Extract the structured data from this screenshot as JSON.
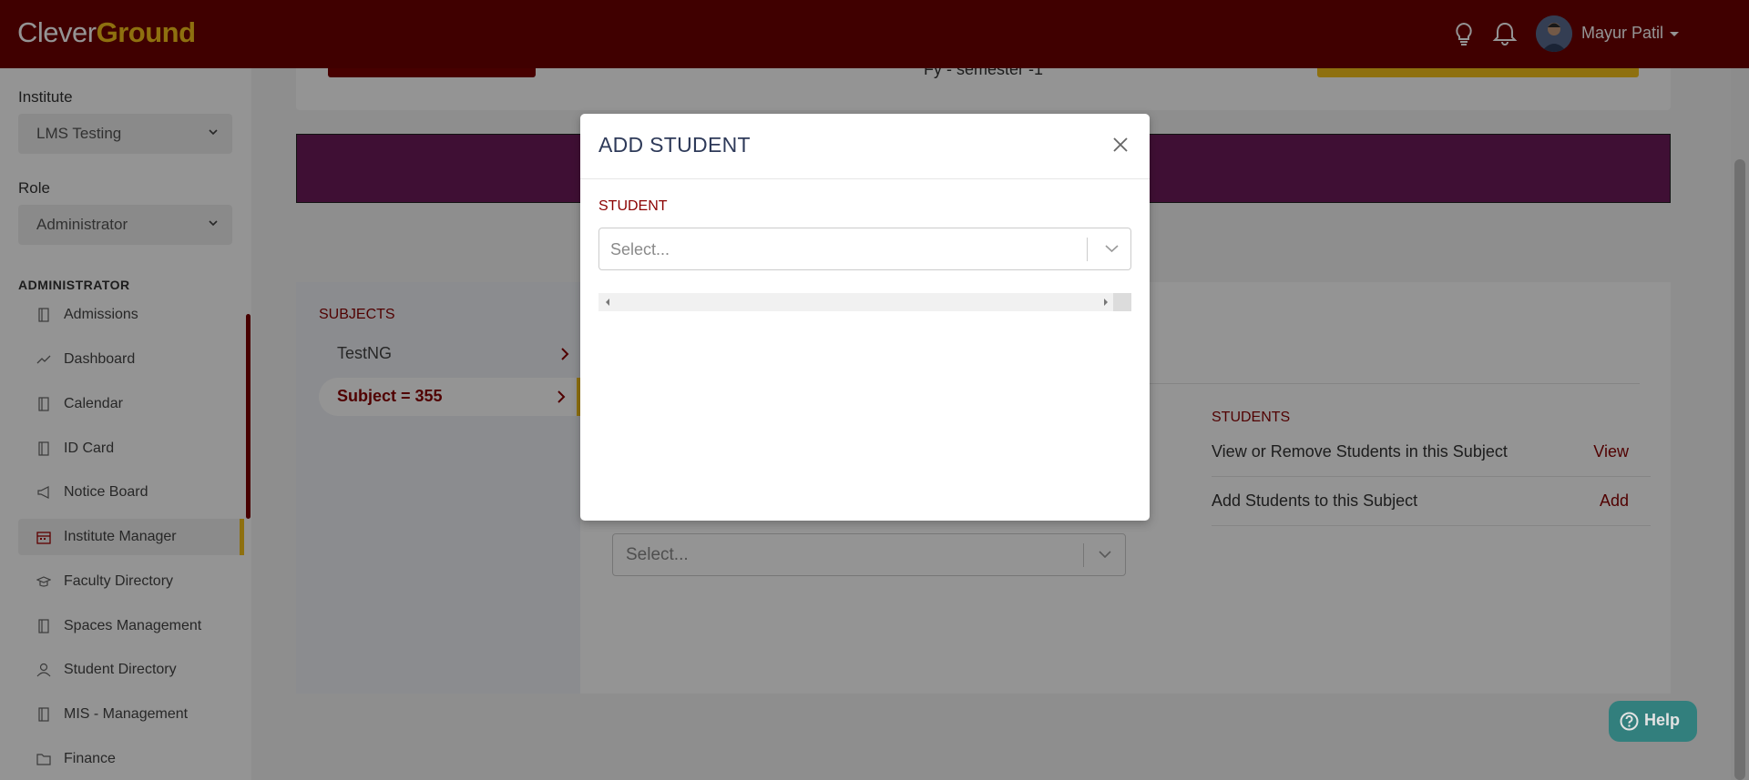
{
  "header": {
    "logo_part1": "Clever",
    "logo_part2": "Ground",
    "user_name": "Mayur Patil",
    "bg_color": "#6e0000",
    "accent_color": "#f5c21b"
  },
  "sidebar": {
    "institute_label": "Institute",
    "institute_value": "LMS Testing",
    "role_label": "Role",
    "role_value": "Administrator",
    "section_title": "ADMINISTRATOR",
    "items": [
      {
        "label": "Admissions",
        "icon": "book-icon"
      },
      {
        "label": "Dashboard",
        "icon": "trend-icon"
      },
      {
        "label": "Calendar",
        "icon": "book-icon"
      },
      {
        "label": "ID Card",
        "icon": "book-icon"
      },
      {
        "label": "Notice Board",
        "icon": "megaphone-icon"
      },
      {
        "label": "Institute Manager",
        "icon": "calendar-icon",
        "active": true
      },
      {
        "label": "Faculty Directory",
        "icon": "graduation-cap-icon"
      },
      {
        "label": "Spaces Management",
        "icon": "book-icon"
      },
      {
        "label": "Student Directory",
        "icon": "user-icon"
      },
      {
        "label": "MIS - Management",
        "icon": "book-icon"
      },
      {
        "label": "Finance",
        "icon": "folder-icon"
      }
    ]
  },
  "main": {
    "fy_text": "Fy - semester -1",
    "subjects_title": "SUBJECTS",
    "subjects": [
      {
        "label": "TestNG"
      },
      {
        "label": "Subject = 355",
        "active": true
      }
    ],
    "students_title": "STUDENTS",
    "students_rows": [
      {
        "text": "View or Remove Students in this Subject",
        "link": "View"
      },
      {
        "text": "Add Students to this Subject",
        "link": "Add"
      }
    ],
    "background_select_placeholder": "Select..."
  },
  "modal": {
    "title": "ADD STUDENT",
    "field_label": "STUDENT",
    "select_placeholder": "Select..."
  },
  "help": {
    "label": "Help"
  }
}
